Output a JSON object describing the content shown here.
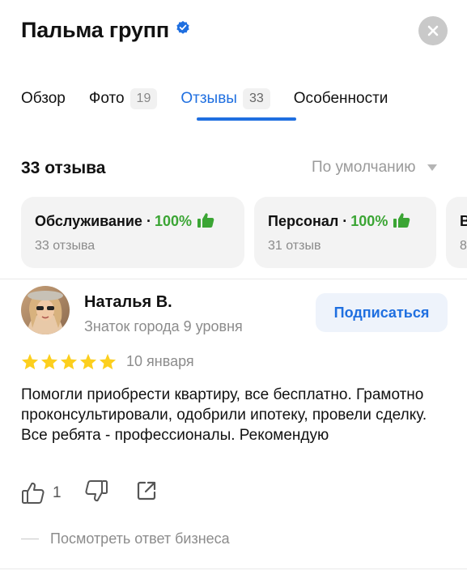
{
  "header": {
    "title": "Пальма групп",
    "verified_icon": "verified-check-icon",
    "close_icon": "close-icon"
  },
  "tabs": [
    {
      "label": "Обзор",
      "count": ""
    },
    {
      "label": "Фото",
      "count": "19"
    },
    {
      "label": "Отзывы",
      "count": "33",
      "active": true
    },
    {
      "label": "Особенности",
      "count": ""
    }
  ],
  "reviews_summary": {
    "count_label": "33 отзыва",
    "sort_label": "По умолчанию"
  },
  "aspects": [
    {
      "name": "Обслуживание",
      "percent": "100%",
      "reviews": "33 отзыва"
    },
    {
      "name": "Персонал",
      "percent": "100%",
      "reviews": "31 отзыв"
    },
    {
      "name": "В",
      "percent": "",
      "reviews": "8"
    }
  ],
  "review": {
    "author": "Наталья В.",
    "level": "Знаток города 9 уровня",
    "subscribe_label": "Подписаться",
    "rating": 5,
    "date": "10 января",
    "text": "Помогли приобрести квартиру, все бесплатно. Грамотно проконсультировали, одобрили ипотеку, провели сделку. Все ребята - профессионалы. Рекомендую",
    "likes": "1",
    "business_reply_label": "Посмотреть ответ бизнеса"
  },
  "colors": {
    "accent": "#1f6fe0",
    "positive": "#3ba534",
    "star": "#fccf1e"
  }
}
